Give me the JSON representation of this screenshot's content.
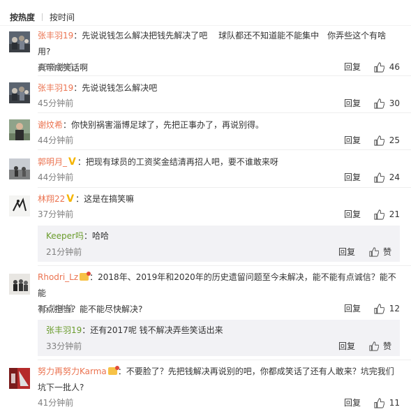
{
  "sort": {
    "hot": "按热度",
    "time": "按时间"
  },
  "labels": {
    "reply": "回复",
    "like_sub": "赞"
  },
  "comments": [
    {
      "user": "张丰羽19",
      "text": "：先说说钱怎么解决把钱先解决了吧　 球队都还不知道能不能集中　你弄些这个有啥用?",
      "text2": "真带成笑话啊",
      "time": "43分钟前",
      "likes": "46",
      "avatar": "crowd-photo"
    },
    {
      "user": "张丰羽19",
      "text": "：先说说钱怎么解决吧",
      "time": "45分钟前",
      "likes": "30",
      "avatar": "crowd-photo"
    },
    {
      "user": "谢炆希",
      "text": "：你快别祸害淄博足球了，先把正事办了，再说别得。",
      "time": "44分钟前",
      "likes": "25",
      "avatar": "person-photo"
    },
    {
      "user": "郭明月_",
      "badge": "V",
      "text": "：把现有球员的工资奖金结清再招人吧，要不谁敢来呀",
      "time": "44分钟前",
      "likes": "24",
      "avatar": "stadium-photo"
    },
    {
      "user": "林翔22",
      "badge": "V",
      "text": "：这是在搞笑嘛",
      "time": "37分钟前",
      "likes": "21",
      "avatar": "sketch-photo",
      "sub": {
        "user": "Keeper吗",
        "text": "：哈哈",
        "time": "21分钟前"
      }
    },
    {
      "user": "Rhodri_Lz",
      "text": "：2018年、2019年和2020年的历史遗留问题至今未解决，能不能有点诚信？能不能",
      "text2": "有点担当？能不能尽快解决?",
      "time": "35分钟前",
      "likes": "12",
      "avatar": "team-photo",
      "sub": {
        "user": "张丰羽19",
        "text": "：还有2017呢  钱不解决弄些笑话出来",
        "time": "33分钟前"
      }
    },
    {
      "user": "努力再努力Karma",
      "text": "：不要脸了？先把钱解决再说别的吧，你都成笑话了还有人敢来？坑完我们",
      "text2": "坑下一批人?",
      "time": "41分钟前",
      "likes": "11",
      "avatar": "red-photo"
    }
  ]
}
